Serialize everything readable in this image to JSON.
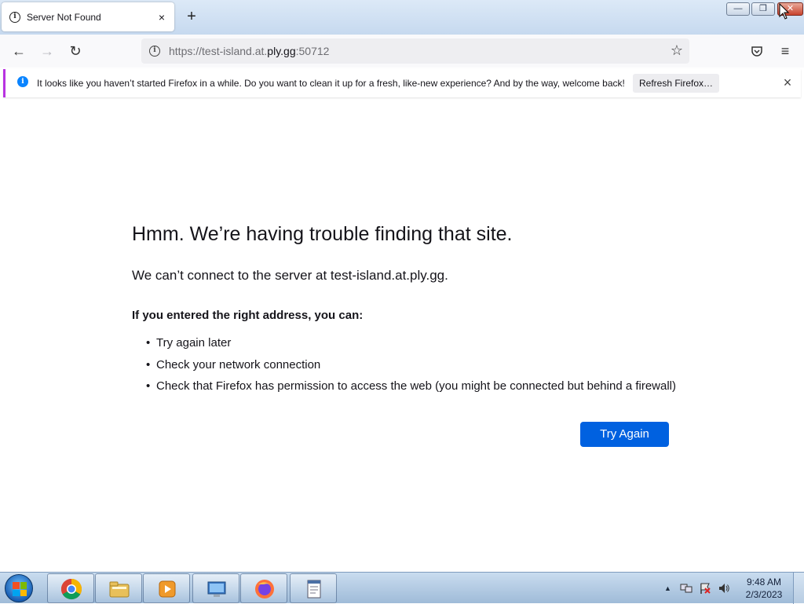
{
  "tab": {
    "title": "Server Not Found",
    "close": "×",
    "new_tab": "+"
  },
  "window_controls": {
    "minimize": "—",
    "maximize": "❐",
    "close": "✕"
  },
  "nav": {
    "back": "←",
    "forward": "→",
    "reload": "↻",
    "url_prefix": "https://test-island.at.",
    "url_host": "ply.gg",
    "url_suffix": ":50712",
    "bookmark_star": "☆",
    "pocket": "◡",
    "menu": "≡"
  },
  "notification": {
    "text": "It looks like you haven’t started Firefox in a while. Do you want to clean it up for a fresh, like-new experience? And by the way, welcome back!",
    "button": "Refresh Firefox…",
    "close": "×"
  },
  "error": {
    "title": "Hmm. We’re having trouble finding that site.",
    "description": "We can’t connect to the server at test-island.at.ply.gg.",
    "subheading": "If you entered the right address, you can:",
    "suggestions": [
      "Try again later",
      "Check your network connection",
      "Check that Firefox has permission to access the web (you might be connected but behind a firewall)"
    ],
    "try_again": "Try Again"
  },
  "taskbar": {
    "apps": [
      "chrome-icon",
      "file-explorer-icon",
      "media-player-icon",
      "computer-icon",
      "firefox-icon",
      "notepad-icon"
    ],
    "tray_arrow": "▲",
    "clock_time": "9:48 AM",
    "clock_date": "2/3/2023"
  },
  "colors": {
    "accent_blue": "#0061e0",
    "notification_bar": "#b833e1",
    "info_blue": "#0a84ff"
  }
}
